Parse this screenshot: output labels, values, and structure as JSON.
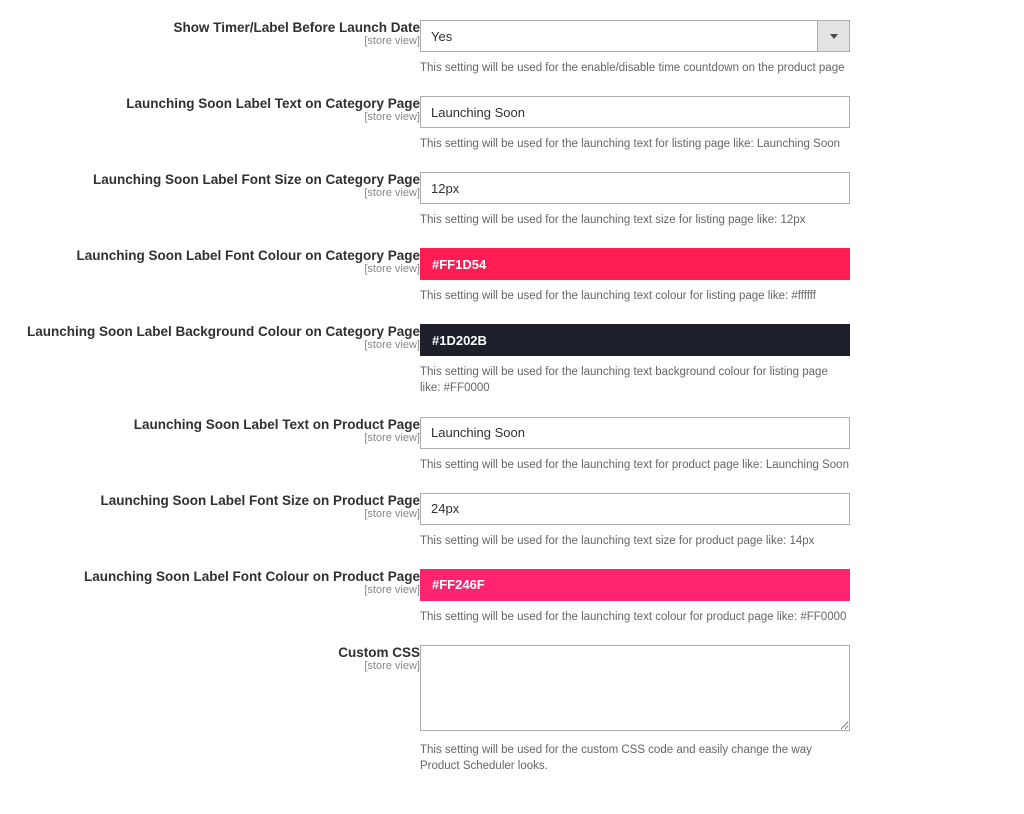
{
  "scope_label": "[store view]",
  "fields": [
    {
      "key": "show_timer",
      "label": "Show Timer/Label Before Launch Date",
      "type": "select",
      "value": "Yes",
      "help": "This setting will be used for the enable/disable time countdown on the product page"
    },
    {
      "key": "cat_label_text",
      "label": "Launching Soon Label Text on Category Page",
      "type": "text",
      "value": "Launching Soon",
      "help": "This setting will be used for the launching text for listing page like: Launching Soon"
    },
    {
      "key": "cat_font_size",
      "label": "Launching Soon Label Font Size on Category Page",
      "type": "text",
      "value": "12px",
      "help": "This setting will be used for the launching text size for listing page like: 12px"
    },
    {
      "key": "cat_font_color",
      "label": "Launching Soon Label Font Colour on Category Page",
      "type": "color",
      "value": "#FF1D54",
      "help": "This setting will be used for the launching text colour for listing page like: #ffffff"
    },
    {
      "key": "cat_bg_color",
      "label": "Launching Soon Label Background Colour on Category Page",
      "type": "color",
      "value": "#1D202B",
      "help": "This setting will be used for the launching text background colour for listing page like: #FF0000"
    },
    {
      "key": "prod_label_text",
      "label": "Launching Soon Label Text on Product Page",
      "type": "text",
      "value": "Launching Soon",
      "help": "This setting will be used for the launching text for product page like: Launching Soon"
    },
    {
      "key": "prod_font_size",
      "label": "Launching Soon Label Font Size on Product Page",
      "type": "text",
      "value": "24px",
      "help": "This setting will be used for the launching text size for product page like: 14px"
    },
    {
      "key": "prod_font_color",
      "label": "Launching Soon Label Font Colour on Product Page",
      "type": "color",
      "value": "#FF246F",
      "help": "This setting will be used for the launching text colour for product page like: #FF0000"
    },
    {
      "key": "custom_css",
      "label": "Custom CSS",
      "type": "textarea",
      "value": "",
      "help": "This setting will be used for the custom CSS code and easily change the way Product Scheduler looks."
    }
  ]
}
